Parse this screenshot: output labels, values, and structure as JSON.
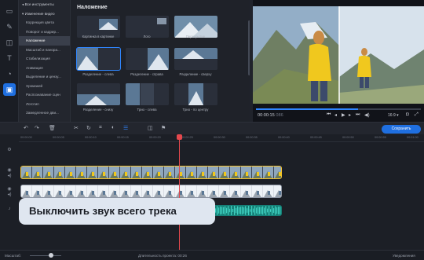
{
  "sidebar": {
    "tools": [
      "import-icon",
      "wand-icon",
      "transitions-icon",
      "text-icon",
      "stickers-icon",
      "overlay-icon"
    ],
    "categories": [
      {
        "label": "Все инструменты",
        "head": true
      },
      {
        "label": "Изменение видео",
        "head": true
      },
      {
        "label": "Коррекция цвета"
      },
      {
        "label": "Поворот и кадрир..."
      },
      {
        "label": "Наложение",
        "active": true
      },
      {
        "label": "Масштаб и панора..."
      },
      {
        "label": "Стабилизация"
      },
      {
        "label": "Анимация"
      },
      {
        "label": "Выделение и цензу..."
      },
      {
        "label": "Хромакей"
      },
      {
        "label": "Распознавание сцен"
      },
      {
        "label": "Логотип"
      },
      {
        "label": "Замедленное дви..."
      }
    ]
  },
  "overlay_panel": {
    "title": "Наложение",
    "items": [
      "Картинка в картинке",
      "Лого",
      "Перекрытие",
      "Разделение - слева",
      "Разделение - справа",
      "Разделение - сверху",
      "Разделение - снизу",
      "Трио - слева",
      "Трио - по центру"
    ]
  },
  "preview": {
    "time": "00:00:15",
    "time_ms": "086",
    "aspect": "16:9 ▾",
    "progress": 0.62
  },
  "toolbar": {
    "save_label": "Сохранить"
  },
  "timeline": {
    "ticks": [
      "00:00:00",
      "00:00:05",
      "00:00:10",
      "00:00:15",
      "00:00:20",
      "00:00:25",
      "00:00:30",
      "00:00:35",
      "00:00:40",
      "00:00:45",
      "00:00:50",
      "00:00:55",
      "00:01:00"
    ]
  },
  "tooltip": {
    "text": "Выключить звук всего трека"
  },
  "status": {
    "scale_label": "Масштаб:",
    "duration_label": "Длительность проекта: 00:26",
    "notifications": "Уведомления"
  }
}
